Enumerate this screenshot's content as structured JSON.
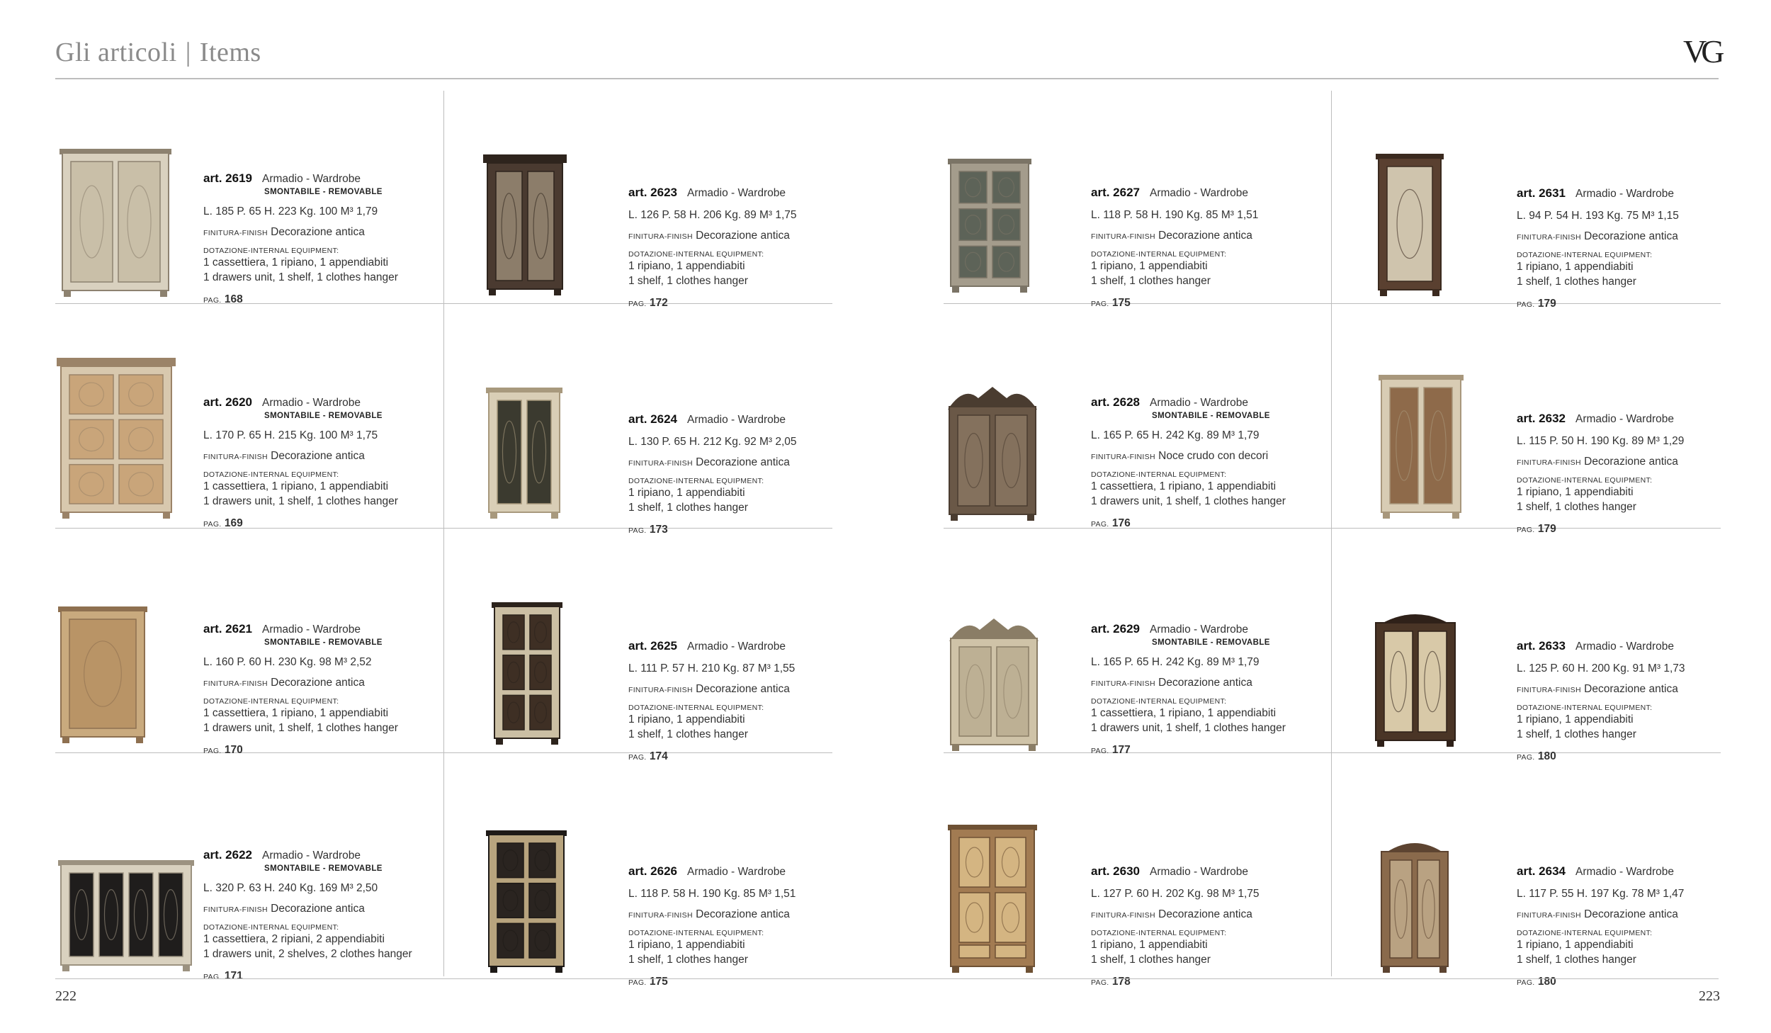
{
  "header": {
    "title_it": "Gli articoli",
    "separator": "|",
    "title_en": "Items",
    "logo": "VG"
  },
  "folio": {
    "left": "222",
    "right": "223"
  },
  "labels": {
    "finish": "Finitura-Finish",
    "equipment": "Dotazione-Internal equipment:",
    "pag": "Pag."
  },
  "items": [
    {
      "art": "art. 2619",
      "desc": "Armadio - Wardrobe",
      "removable": "Smontabile - Removable",
      "dims": "L. 185  P. 65  H. 223  Kg. 100  M³ 1,79",
      "finish": "Decorazione antica",
      "equip_it": "1 cassettiera, 1 ripiano, 1 appendiabiti",
      "equip_en": "1 drawers unit, 1 shelf, 1 clothes hanger",
      "pag": "168",
      "body": "#d9d1bf",
      "panel": "#c9bfa8",
      "trim": "#8d8270",
      "style": "carved-2"
    },
    {
      "art": "art. 2623",
      "desc": "Armadio - Wardrobe",
      "removable": "",
      "dims": "L. 126  P. 58  H. 206  Kg. 89  M³ 1,75",
      "finish": "Decorazione antica",
      "equip_it": "1 ripiano, 1 appendiabiti",
      "equip_en": "1 shelf, 1 clothes hanger",
      "pag": "172",
      "body": "#4a3a30",
      "panel": "#8c7d6a",
      "trim": "#2e241d",
      "style": "crown-2"
    },
    {
      "art": "art. 2627",
      "desc": "Armadio - Wardrobe",
      "removable": "",
      "dims": "L. 118  P. 58  H. 190  Kg. 85  M³ 1,51",
      "finish": "Decorazione antica",
      "equip_it": "1 ripiano, 1 appendiabiti",
      "equip_en": "1 shelf, 1 clothes hanger",
      "pag": "175",
      "body": "#a49c8c",
      "panel": "#5d6358",
      "trim": "#7b7466",
      "style": "grid-2"
    },
    {
      "art": "art. 2631",
      "desc": "Armadio - Wardrobe",
      "removable": "",
      "dims": "L. 94  P. 54  H. 193  Kg. 75  M³ 1,15",
      "finish": "Decorazione antica",
      "equip_it": "1 ripiano, 1 appendiabiti",
      "equip_en": "1 shelf, 1 clothes hanger",
      "pag": "179",
      "body": "#5a4030",
      "panel": "#cfc4ad",
      "trim": "#3b2a1f",
      "style": "single"
    },
    {
      "art": "art. 2620",
      "desc": "Armadio - Wardrobe",
      "removable": "Smontabile - Removable",
      "dims": "L. 170  P. 65  H. 215  Kg. 100  M³ 1,75",
      "finish": "Decorazione antica",
      "equip_it": "1 cassettiera, 1 ripiano, 1 appendiabiti",
      "equip_en": "1 drawers unit, 1 shelf, 1 clothes hanger",
      "pag": "169",
      "body": "#d8c8ae",
      "panel": "#c9a57a",
      "trim": "#9b8368",
      "style": "cornice-3"
    },
    {
      "art": "art. 2624",
      "desc": "Armadio - Wardrobe",
      "removable": "",
      "dims": "L. 130  P. 65  H. 212  Kg. 92  M³ 2,05",
      "finish": "Decorazione antica",
      "equip_it": "1 ripiano, 1 appendiabiti",
      "equip_en": "1 shelf, 1 clothes hanger",
      "pag": "173",
      "body": "#d9ceb6",
      "panel": "#3b3a2f",
      "trim": "#a8997d",
      "style": "tall-2"
    },
    {
      "art": "art. 2628",
      "desc": "Armadio - Wardrobe",
      "removable": "Smontabile - Removable",
      "dims": "L. 165  P. 65  H. 242  Kg. 89  M³ 1,79",
      "finish": "Noce crudo con decori",
      "equip_it": "1 cassettiera, 1 ripiano, 1 appendiabiti",
      "equip_en": "1 drawers unit, 1 shelf, 1 clothes hanger",
      "pag": "176",
      "body": "#6a5847",
      "panel": "#84715d",
      "trim": "#4a3c30",
      "style": "pediment-2"
    },
    {
      "art": "art. 2632",
      "desc": "Armadio - Wardrobe",
      "removable": "",
      "dims": "L. 115  P. 50  H. 190  Kg. 89  M³ 1,29",
      "finish": "Decorazione antica",
      "equip_it": "1 ripiano, 1 appendiabiti",
      "equip_en": "1 shelf, 1 clothes hanger",
      "pag": "179",
      "body": "#d8ccb4",
      "panel": "#8e6a4a",
      "trim": "#a8977c",
      "style": "tall-2"
    },
    {
      "art": "art. 2621",
      "desc": "Armadio - Wardrobe",
      "removable": "Smontabile - Removable",
      "dims": "L. 160  P. 60  H. 230  Kg. 98  M³ 2,52",
      "finish": "Decorazione antica",
      "equip_it": "1 cassettiera, 1 ripiano, 1 appendiabiti",
      "equip_en": "1 drawers unit, 1 shelf, 1 clothes hanger",
      "pag": "170",
      "body": "#c9aa7e",
      "panel": "#b99466",
      "trim": "#8e7050",
      "style": "single-wide"
    },
    {
      "art": "art. 2625",
      "desc": "Armadio - Wardrobe",
      "removable": "",
      "dims": "L. 111  P. 57  H. 210  Kg. 87  M³ 1,55",
      "finish": "Decorazione antica",
      "equip_it": "1 ripiano, 1 appendiabiti",
      "equip_en": "1 shelf, 1 clothes hanger",
      "pag": "174",
      "body": "#cbbfa4",
      "panel": "#3e2f24",
      "trim": "#2c231c",
      "style": "grid-4"
    },
    {
      "art": "art. 2629",
      "desc": "Armadio - Wardrobe",
      "removable": "Smontabile - Removable",
      "dims": "L. 165  P. 65  H. 242  Kg. 89  M³ 1,79",
      "finish": "Decorazione antica",
      "equip_it": "1 cassettiera, 1 ripiano, 1 appendiabiti",
      "equip_en": "1 drawers unit, 1 shelf, 1 clothes hanger",
      "pag": "177",
      "body": "#cfc3a8",
      "panel": "#bdb094",
      "trim": "#8a7d66",
      "style": "pediment-2"
    },
    {
      "art": "art. 2633",
      "desc": "Armadio - Wardrobe",
      "removable": "",
      "dims": "L. 125  P. 60  H. 200  Kg. 91  M³ 1,73",
      "finish": "Decorazione antica",
      "equip_it": "1 ripiano, 1 appendiabiti",
      "equip_en": "1 shelf, 1 clothes hanger",
      "pag": "180",
      "body": "#4a3526",
      "panel": "#d8c9a8",
      "trim": "#2f2119",
      "style": "arch-2"
    },
    {
      "art": "art. 2622",
      "desc": "Armadio - Wardrobe",
      "removable": "Smontabile - Removable",
      "dims": "L. 320  P. 63  H. 240  Kg. 169  M³ 2,50",
      "finish": "Decorazione antica",
      "equip_it": "1 cassettiera, 2 ripiani, 2 appendiabiti",
      "equip_en": "1 drawers unit, 2 shelves, 2 clothes hanger",
      "pag": "171",
      "body": "#d9d1bf",
      "panel": "#1f1d1c",
      "trim": "#9c9280",
      "style": "wide-4"
    },
    {
      "art": "art. 2626",
      "desc": "Armadio - Wardrobe",
      "removable": "",
      "dims": "L. 118  P. 58  H. 190  Kg. 85  M³ 1,51",
      "finish": "Decorazione antica",
      "equip_it": "1 ripiano, 1 appendiabiti",
      "equip_en": "1 shelf, 1 clothes hanger",
      "pag": "175",
      "body": "#b8a47e",
      "panel": "#2a2420",
      "trim": "#1e1a17",
      "style": "grid-4"
    },
    {
      "art": "art. 2630",
      "desc": "Armadio - Wardrobe",
      "removable": "",
      "dims": "L. 127  P. 60  H. 202  Kg. 98  M³ 1,75",
      "finish": "Decorazione antica",
      "equip_it": "1 ripiano, 1 appendiabiti",
      "equip_en": "1 shelf, 1 clothes hanger",
      "pag": "178",
      "body": "#a27b52",
      "panel": "#d4b582",
      "trim": "#6e5134",
      "style": "drawer-2"
    },
    {
      "art": "art. 2634",
      "desc": "Armadio - Wardrobe",
      "removable": "",
      "dims": "L. 117  P. 55  H. 197  Kg. 78  M³ 1,47",
      "finish": "Decorazione antica",
      "equip_it": "1 ripiano, 1 appendiabiti",
      "equip_en": "1 shelf, 1 clothes hanger",
      "pag": "180",
      "body": "#8a6a4c",
      "panel": "#b9a282",
      "trim": "#5d4431",
      "style": "arch-2"
    }
  ]
}
